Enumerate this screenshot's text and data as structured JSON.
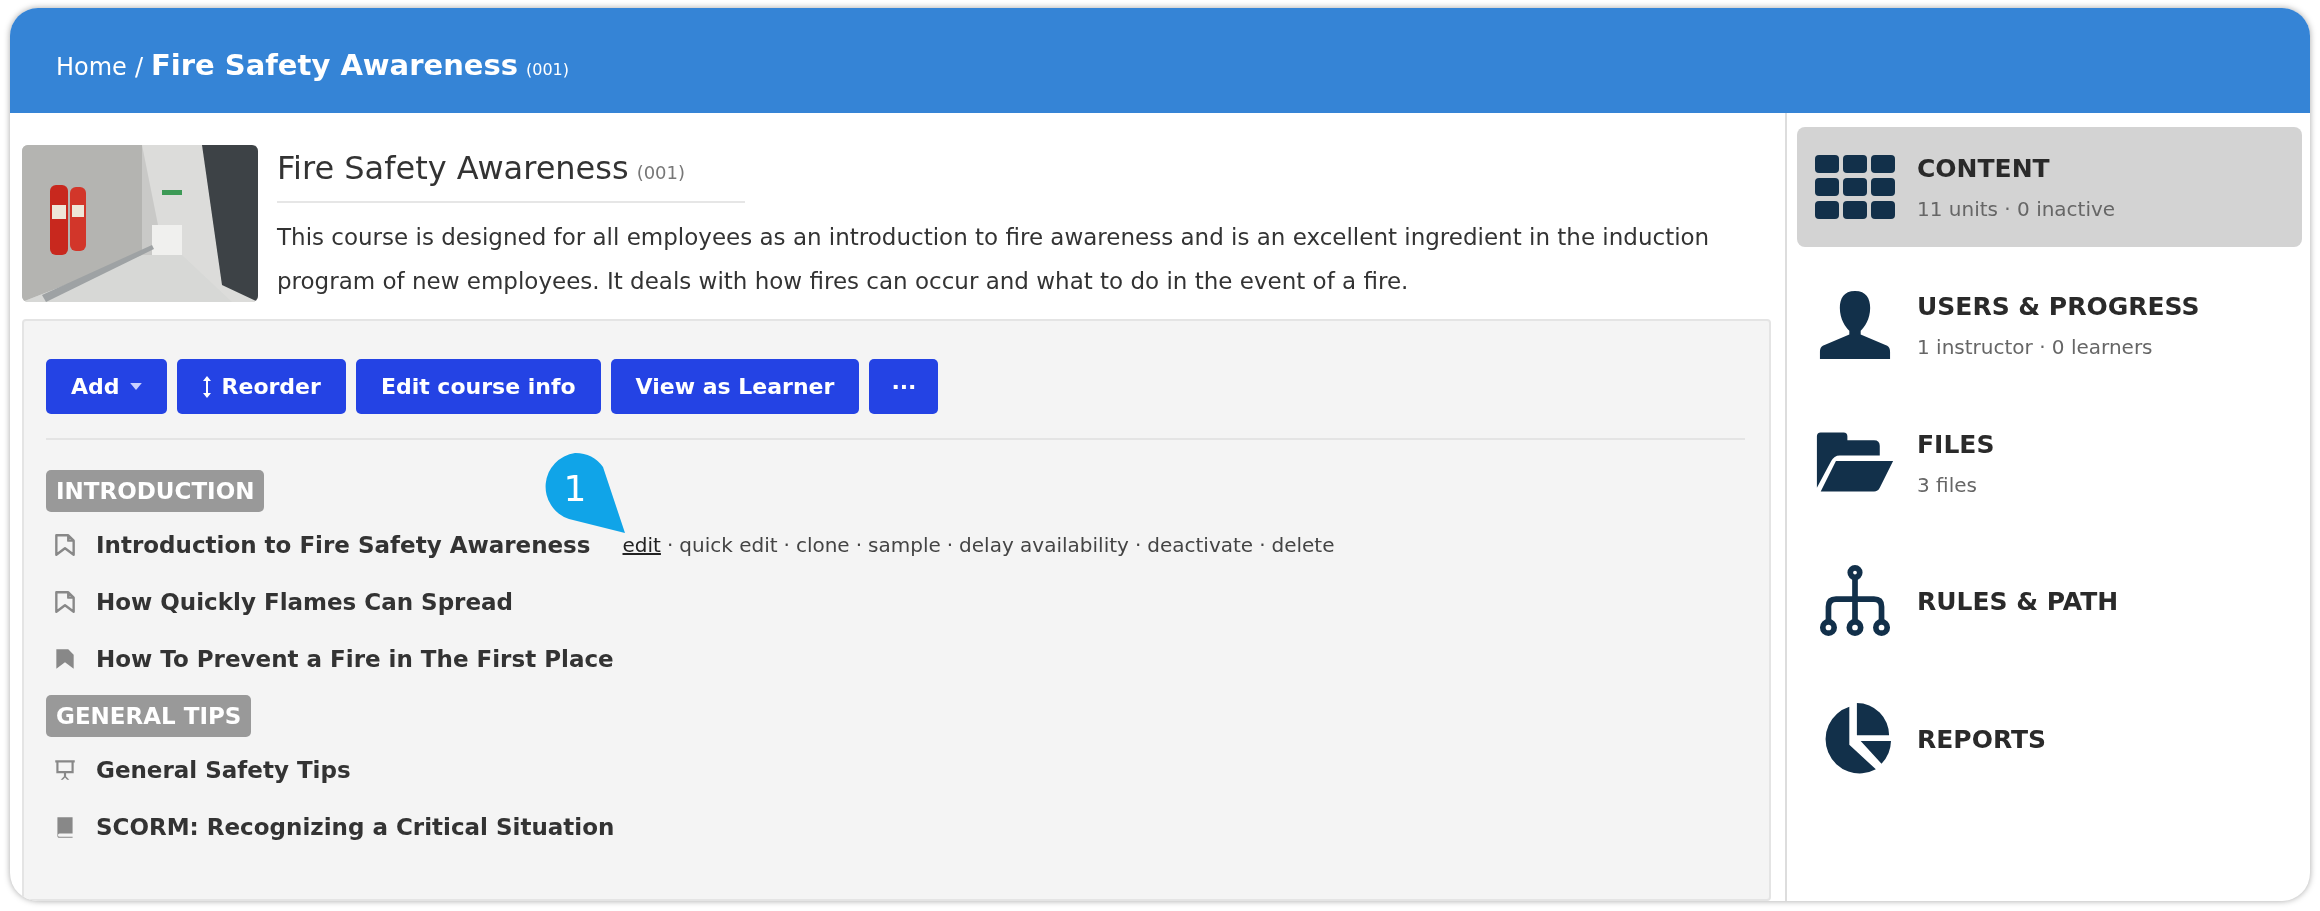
{
  "breadcrumb": {
    "home": "Home",
    "separator": "/",
    "title": "Fire Safety Awareness",
    "code": "(001)"
  },
  "course": {
    "title": "Fire Safety Awareness",
    "code": "(001)",
    "description": "This course is designed for all employees as an introduction to fire awareness and is an excellent ingredient in the induction program of new employees. It deals with how fires can occur and what to do in the event of a fire."
  },
  "toolbar": [
    {
      "label": "Add",
      "kind": "dropdown"
    },
    {
      "label": "Reorder",
      "kind": "reorder"
    },
    {
      "label": "Edit course info",
      "kind": "plain"
    },
    {
      "label": "View as Learner",
      "kind": "plain"
    },
    {
      "label": "···",
      "kind": "more"
    }
  ],
  "sections": [
    {
      "title": "INTRODUCTION",
      "units": [
        {
          "title": "Introduction to Fire Safety Awareness",
          "kind": "page-outline",
          "separator": "·",
          "actions": [
            {
              "label": "edit",
              "underlined": true
            },
            {
              "label": "quick edit",
              "underlined": false
            },
            {
              "label": "clone",
              "underlined": false
            },
            {
              "label": "sample",
              "underlined": false
            },
            {
              "label": "delay availability",
              "underlined": false
            },
            {
              "label": "deactivate",
              "underlined": false
            },
            {
              "label": "delete",
              "underlined": false
            }
          ],
          "callout": "1"
        },
        {
          "title": "How Quickly Flames Can Spread",
          "kind": "page-outline"
        },
        {
          "title": "How To Prevent a Fire in The First Place",
          "kind": "page-filled"
        }
      ]
    },
    {
      "title": "GENERAL TIPS",
      "units": [
        {
          "title": "General Safety Tips",
          "kind": "presentation"
        },
        {
          "title": "SCORM: Recognizing a Critical Situation",
          "kind": "scorm"
        }
      ]
    }
  ],
  "sidebar": [
    {
      "title": "CONTENT",
      "subtitle": "11 units · 0 inactive",
      "kind": "grid",
      "selected": true
    },
    {
      "title": "USERS & PROGRESS",
      "subtitle": "1 instructor · 0 learners",
      "kind": "user",
      "selected": false
    },
    {
      "title": "FILES",
      "subtitle": "3 files",
      "kind": "folder",
      "selected": false
    },
    {
      "title": "RULES & PATH",
      "kind": "tree",
      "selected": false
    },
    {
      "title": "REPORTS",
      "kind": "pie",
      "selected": false
    }
  ]
}
